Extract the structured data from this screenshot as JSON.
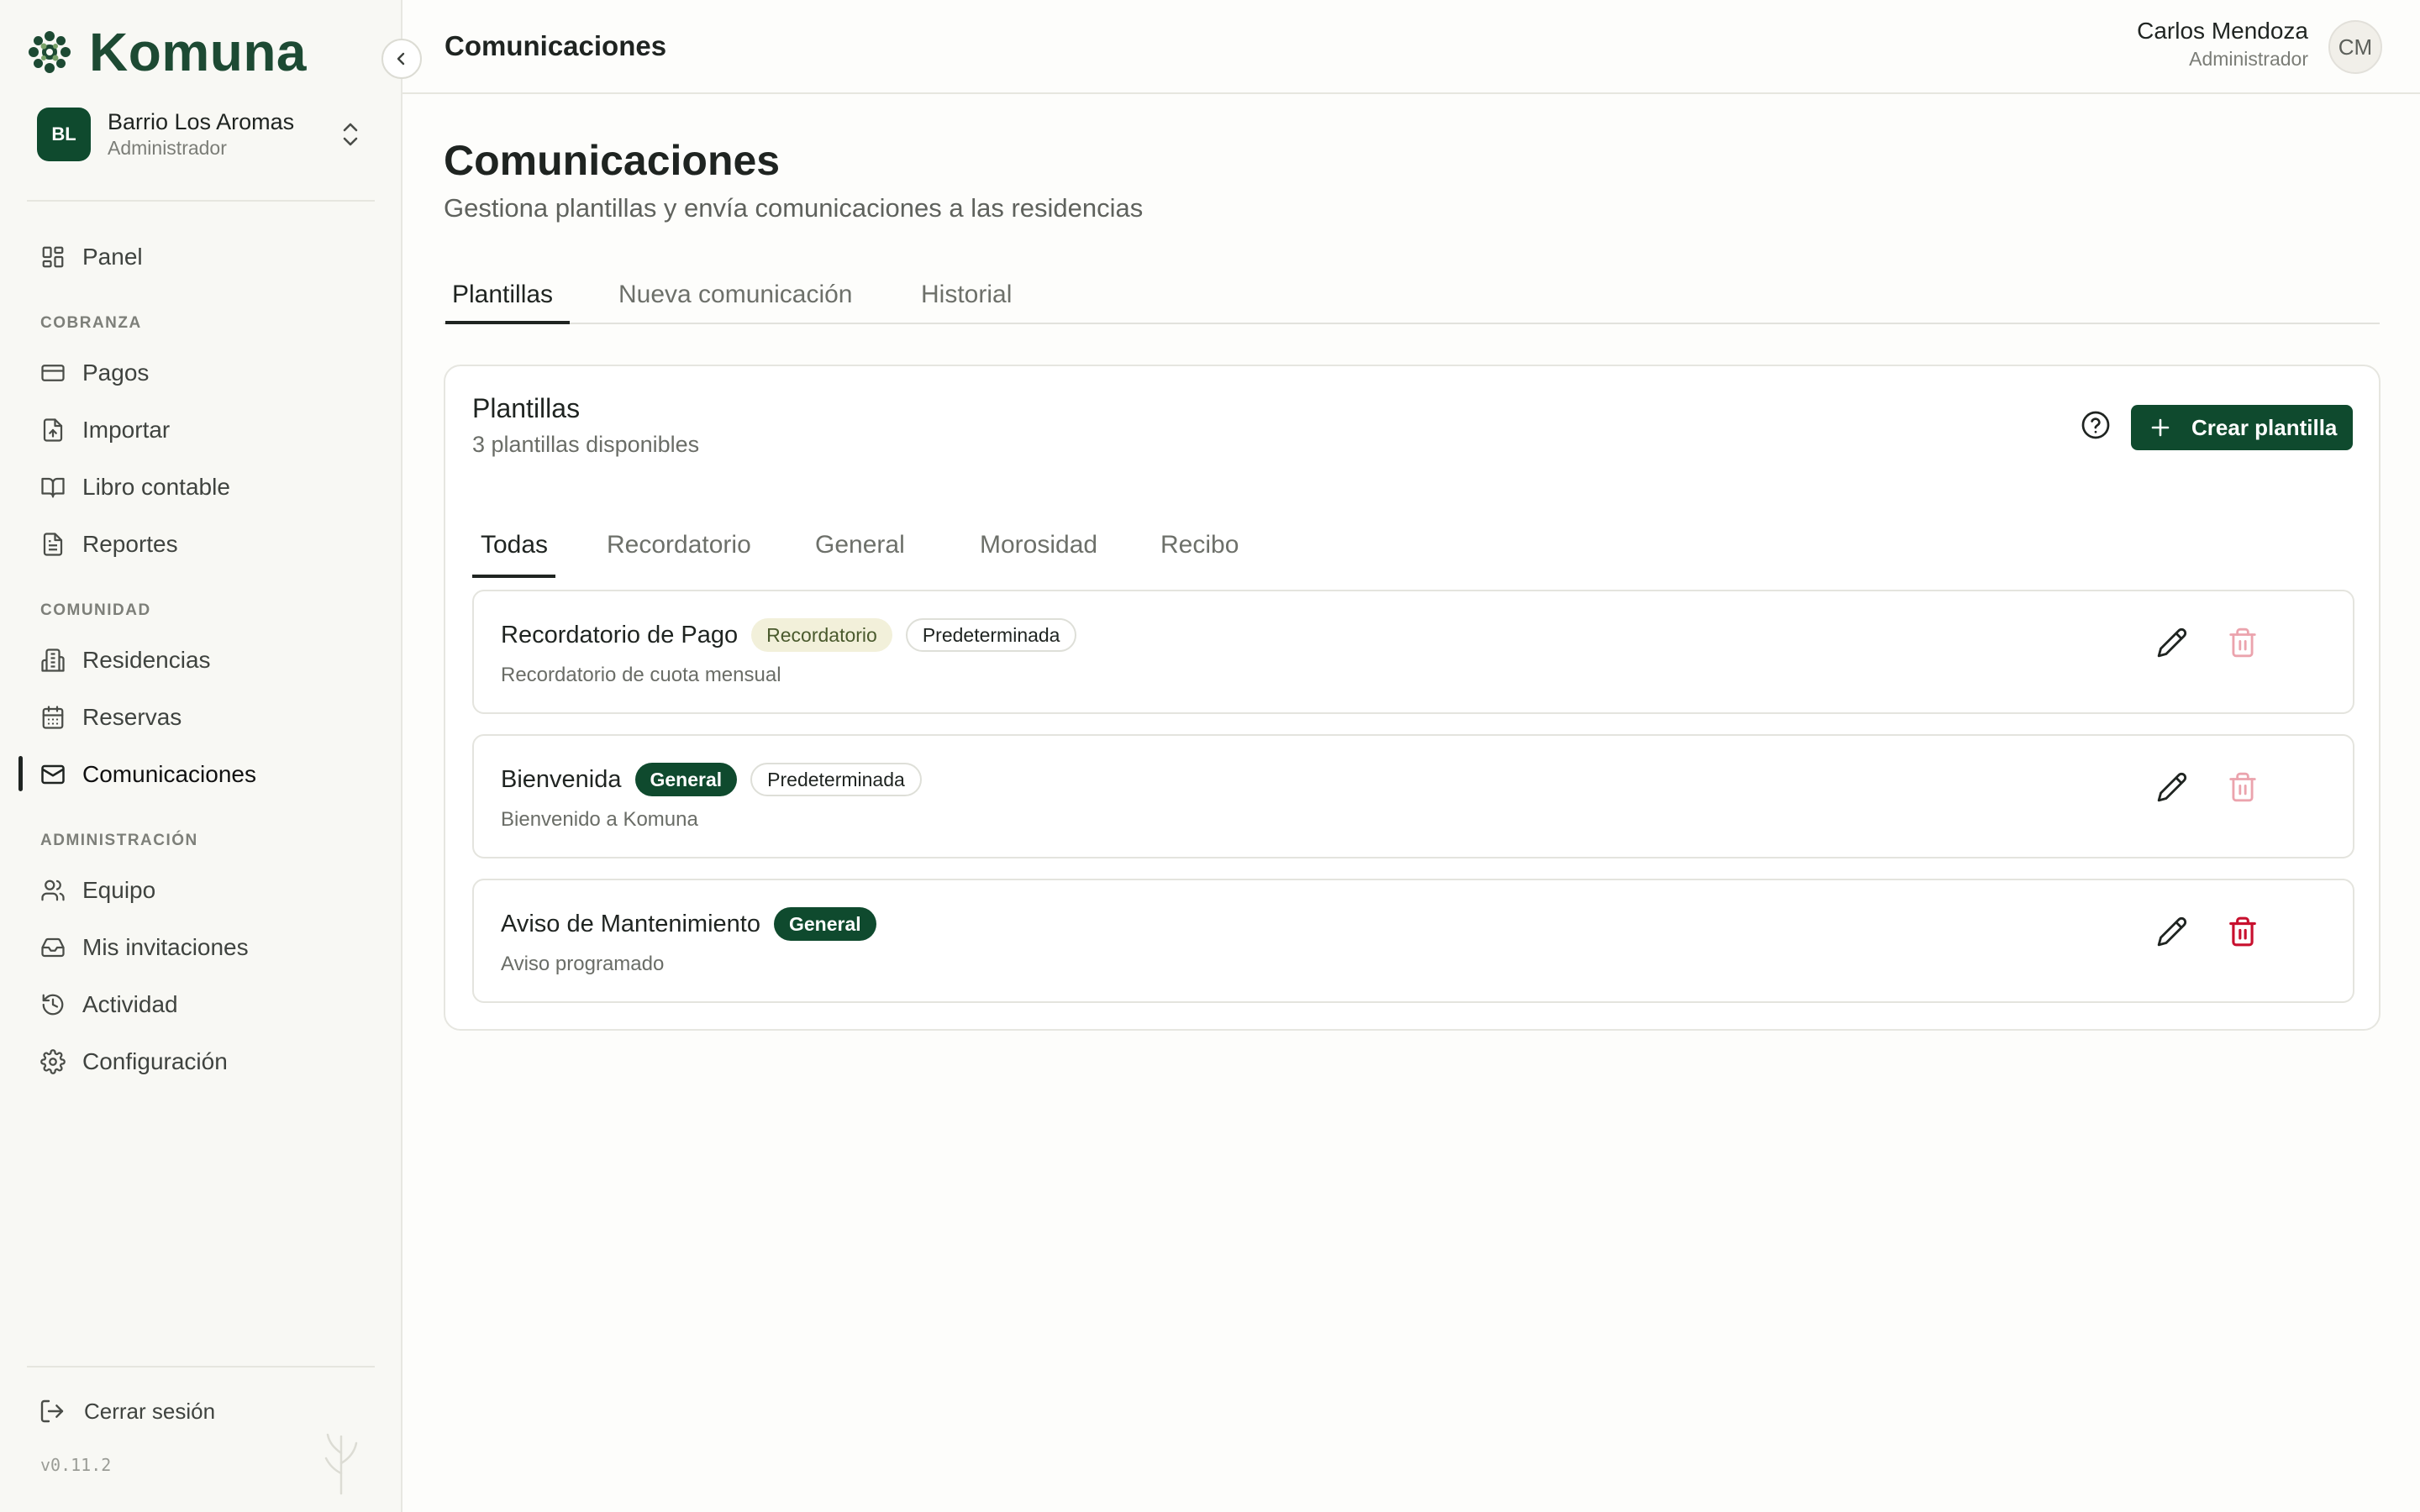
{
  "app": {
    "brand": "Komuna",
    "version": "v0.11.2"
  },
  "org": {
    "initials": "BL",
    "name": "Barrio Los Aromas",
    "role": "Administrador"
  },
  "sidebar": {
    "panel": "Panel",
    "sections": {
      "cobranza": "COBRANZA",
      "comunidad": "COMUNIDAD",
      "administracion": "ADMINISTRACIÓN"
    },
    "items": {
      "pagos": "Pagos",
      "importar": "Importar",
      "libro": "Libro contable",
      "reportes": "Reportes",
      "residencias": "Residencias",
      "reservas": "Reservas",
      "comunicaciones": "Comunicaciones",
      "equipo": "Equipo",
      "invitaciones": "Mis invitaciones",
      "actividad": "Actividad",
      "configuracion": "Configuración"
    },
    "active_item": "comunicaciones",
    "logout": "Cerrar sesión"
  },
  "header": {
    "title": "Comunicaciones",
    "user_name": "Carlos Mendoza",
    "user_role": "Administrador",
    "user_initials": "CM"
  },
  "page": {
    "title": "Comunicaciones",
    "subtitle": "Gestiona plantillas y envía comunicaciones a las residencias",
    "tabs": [
      "Plantillas",
      "Nueva comunicación",
      "Historial"
    ],
    "active_tab": "Plantillas"
  },
  "templates_card": {
    "title": "Plantillas",
    "subtitle": "3 plantillas disponibles",
    "create_label": "Crear plantilla",
    "filters": [
      "Todas",
      "Recordatorio",
      "General",
      "Morosidad",
      "Recibo"
    ],
    "active_filter": "Todas",
    "items": [
      {
        "name": "Recordatorio de Pago",
        "category": "Recordatorio",
        "default_label": "Predeterminada",
        "description": "Recordatorio de cuota mensual",
        "delete_enabled": false
      },
      {
        "name": "Bienvenida",
        "category": "General",
        "default_label": "Predeterminada",
        "description": "Bienvenido a Komuna",
        "delete_enabled": false
      },
      {
        "name": "Aviso de Mantenimiento",
        "category": "General",
        "description": "Aviso programado",
        "delete_enabled": true
      }
    ]
  },
  "colors": {
    "brand": "#0f4a2e",
    "brand_text": "#1d4a33",
    "delete_active": "#c8102e",
    "delete_disabled": "#eba3ad",
    "badge_recordatorio_bg": "#f2f0da"
  }
}
